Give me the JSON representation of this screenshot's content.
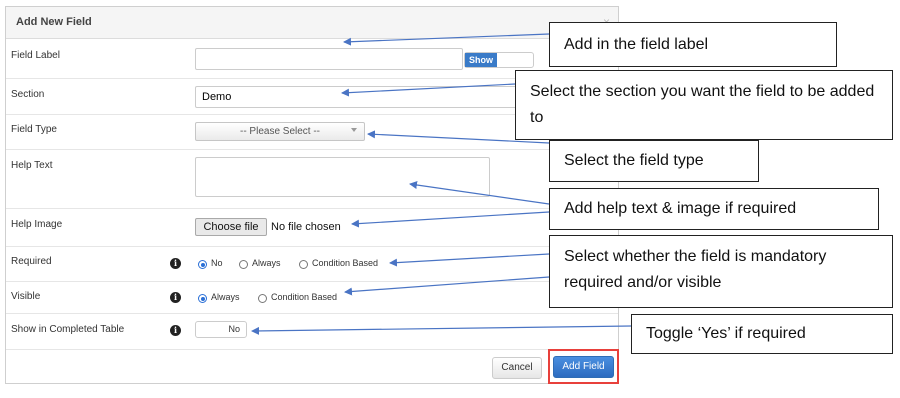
{
  "dialog": {
    "title": "Add New Field",
    "close_icon": "×",
    "fields": {
      "field_label": {
        "label": "Field Label",
        "value": "",
        "show_toggle": "Show"
      },
      "section": {
        "label": "Section",
        "value": "Demo"
      },
      "field_type": {
        "label": "Field Type",
        "value": "-- Please Select --"
      },
      "help_text": {
        "label": "Help Text",
        "value": ""
      },
      "help_image": {
        "label": "Help Image",
        "button": "Choose file",
        "status": "No file chosen"
      },
      "required": {
        "label": "Required",
        "options": [
          "No",
          "Always",
          "Condition Based"
        ],
        "selected": "No"
      },
      "visible": {
        "label": "Visible",
        "options": [
          "Always",
          "Condition Based"
        ],
        "selected": "Always"
      },
      "show_in_completed_table": {
        "label": "Show in Completed Table",
        "toggle": "No"
      }
    },
    "buttons": {
      "cancel": "Cancel",
      "add_field": "Add Field"
    }
  },
  "callouts": {
    "field_label": "Add in the field label",
    "section": "Select the section you want the field to be added to",
    "field_type": "Select the field type",
    "help": "Add help text & image if required",
    "required_visible": "Select whether the field is mandatory required and/or visible",
    "toggle": "Toggle ‘Yes’ if required"
  },
  "colors": {
    "accent": "#3a7bc8",
    "highlight": "#e8403b",
    "arrow": "#4a74c4"
  }
}
